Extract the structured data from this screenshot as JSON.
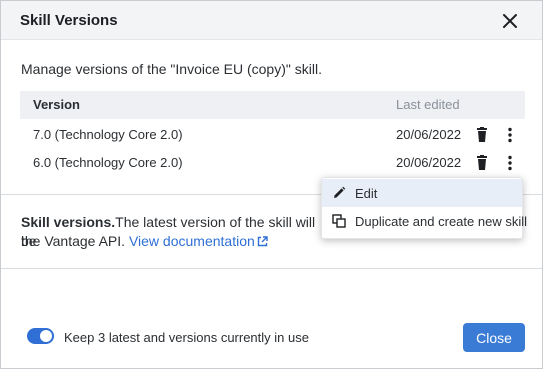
{
  "dialog": {
    "title": "Skill Versions",
    "intro": "Manage versions of the \"Invoice EU (copy)\" skill."
  },
  "table": {
    "columns": {
      "version": "Version",
      "last_edited": "Last edited"
    },
    "rows": [
      {
        "version": "7.0 (Technology Core 2.0)",
        "last_edited": "20/06/2022"
      },
      {
        "version": "6.0 (Technology Core 2.0)",
        "last_edited": "20/06/2022"
      }
    ]
  },
  "context_menu": {
    "items": [
      {
        "label": "Edit",
        "icon": "pencil-icon"
      },
      {
        "label": "Duplicate and create new skill",
        "icon": "duplicate-icon"
      }
    ]
  },
  "info": {
    "bold": "Skill versions.",
    "text_line1": "The latest version of the skill will be",
    "text_line2": "the Vantage API.",
    "link": "View documentation"
  },
  "footer": {
    "toggle_label": "Keep 3 latest and versions currently in use",
    "toggle_on": true,
    "close_label": "Close"
  },
  "colors": {
    "accent": "#3a7bd5",
    "link": "#2f6fd6"
  }
}
